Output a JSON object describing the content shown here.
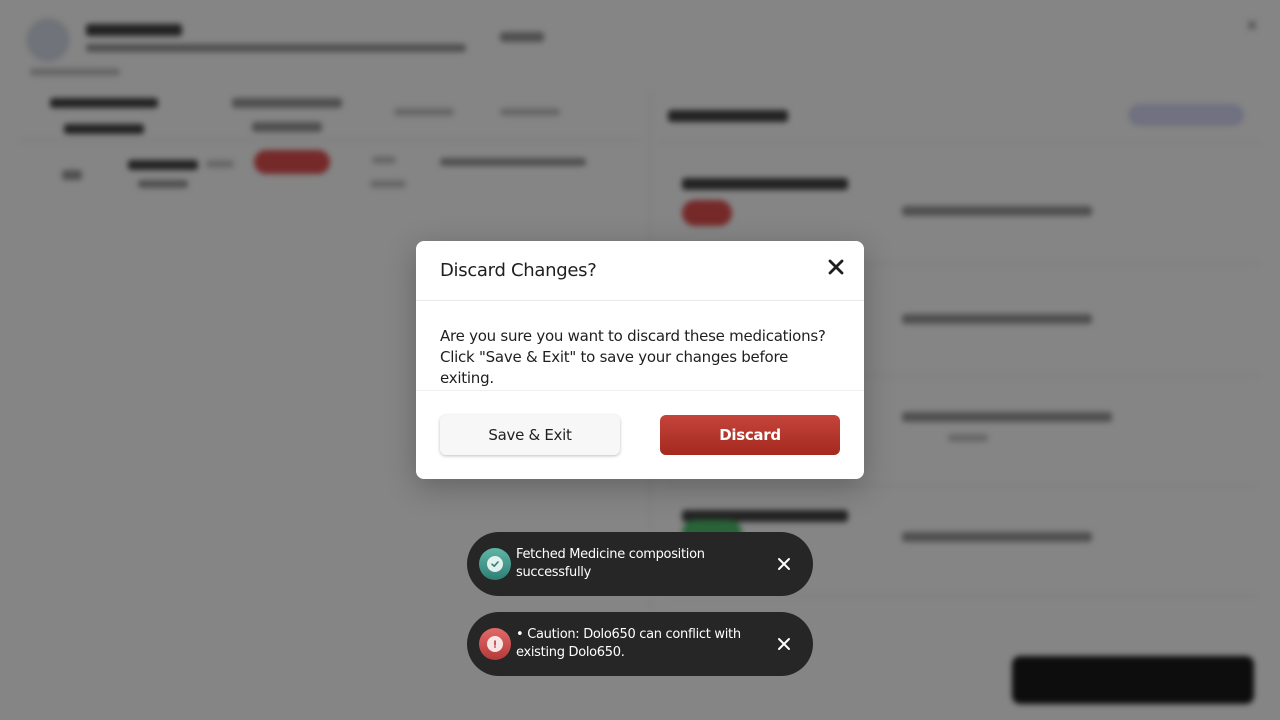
{
  "dialog": {
    "title": "Discard Changes?",
    "message": "Are you sure you want to discard these medications? Click \"Save & Exit\" to save your changes before exiting.",
    "close_icon": "close-icon",
    "save_exit_label": "Save & Exit",
    "discard_label": "Discard"
  },
  "toasts": [
    {
      "type": "success",
      "icon": "check-circle-icon",
      "message": "Fetched Medicine composition successfully"
    },
    {
      "type": "warning",
      "icon": "alert-circle-icon",
      "message": "• Caution: Dolo650 can conflict with existing Dolo650."
    }
  ],
  "colors": {
    "discard_button": "#b2342a",
    "toast_background": "#262626",
    "success_icon": "#3f9487",
    "warning_icon": "#c94a4a",
    "overlay": "rgba(0,0,0,0.48)"
  }
}
